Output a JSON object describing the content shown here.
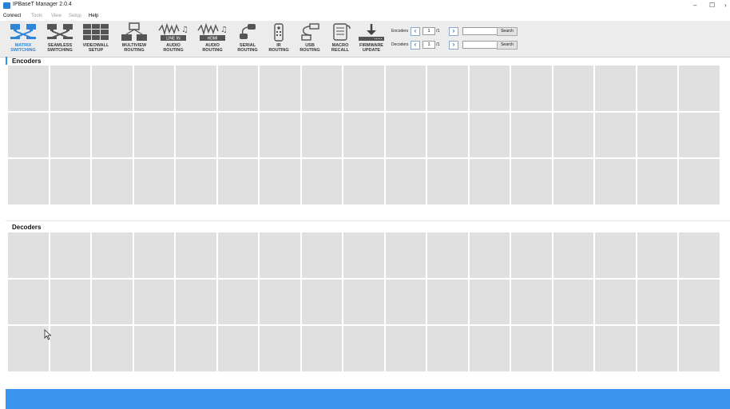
{
  "window": {
    "title": "IPBaseT Manager 2.0.4",
    "minimize": "–",
    "maximize": "☐",
    "close": "›"
  },
  "menu": [
    {
      "label": "Connect",
      "enabled": true
    },
    {
      "label": "Tools",
      "enabled": false
    },
    {
      "label": "View",
      "enabled": false
    },
    {
      "label": "Setup",
      "enabled": false
    },
    {
      "label": "Help",
      "enabled": true
    }
  ],
  "toolbar": {
    "tools": [
      {
        "label": "MATRIX\nSWITCHING",
        "icon": "matrix-switching-icon",
        "active": true
      },
      {
        "label": "SEAMLESS\nSWITCHING",
        "icon": "seamless-switching-icon",
        "active": false
      },
      {
        "label": "VIDEOWALL\nSETUP",
        "icon": "videowall-icon",
        "active": false
      },
      {
        "label": "MULTIVIEW\nROUTING",
        "icon": "multiview-icon",
        "active": false
      },
      {
        "label": "AUDIO\nROUTING",
        "icon": "audio-line-in-icon",
        "sublabel": "LINE IN",
        "active": false
      },
      {
        "label": "AUDIO\nROUTING",
        "icon": "audio-hdmi-icon",
        "sublabel": "HDMI",
        "active": false
      },
      {
        "label": "SERIAL\nROUTING",
        "icon": "serial-icon",
        "active": false
      },
      {
        "label": "IR\nROUTING",
        "icon": "ir-remote-icon",
        "active": false
      },
      {
        "label": "USB\nROUTING",
        "icon": "usb-icon",
        "active": false
      },
      {
        "label": "MACRO\nRECALL",
        "icon": "macro-scroll-icon",
        "active": false
      },
      {
        "label": "FIRMWARE\nUPDATE",
        "icon": "firmware-download-icon",
        "active": false
      }
    ]
  },
  "pagers": {
    "encoders": {
      "label": "Encoders",
      "page": "1",
      "total": "/1",
      "search_label": "Search",
      "search_value": ""
    },
    "decoders": {
      "label": "Decoders",
      "page": "1",
      "total": "/1",
      "search_label": "Search",
      "search_value": ""
    }
  },
  "sections": {
    "encoders": {
      "heading": "Encoders"
    },
    "decoders": {
      "heading": "Decoders"
    }
  },
  "colors": {
    "accent": "#3a93ec",
    "active_label": "#2d86d9",
    "cell": "#e0e0e0",
    "toolbar": "#ececec"
  }
}
